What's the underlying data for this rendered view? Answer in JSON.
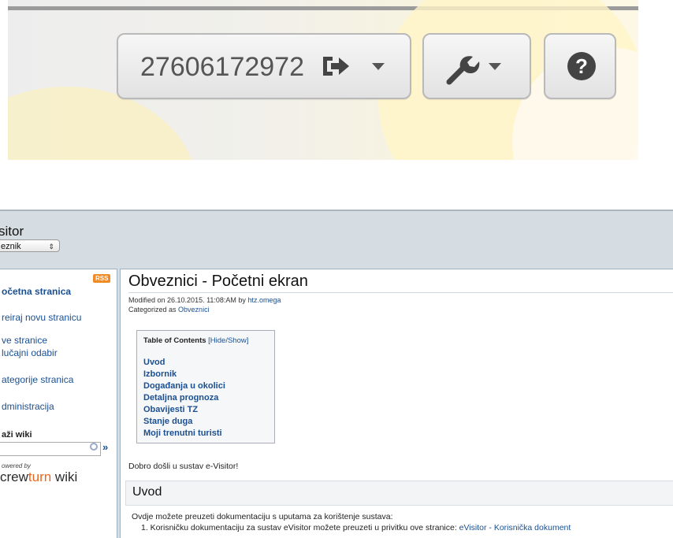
{
  "toolbar": {
    "user_id": "27606172972",
    "help_glyph": "?"
  },
  "wiki": {
    "site_title": "sitor",
    "namespace_select": "eznik",
    "rss_label": "RSS",
    "nav": [
      {
        "label": "očetna stranica"
      },
      {
        "label": "reiraj novu stranicu"
      },
      {
        "label": "ve stranice"
      },
      {
        "label": "lučajni odabir"
      },
      {
        "label": "ategorije stranica"
      },
      {
        "label": "dministracija"
      }
    ],
    "search_label": "aži wiki",
    "search_go": "»",
    "powered_by": "owered by",
    "logo_pre": "crew",
    "logo_accent": "turn",
    "logo_post": " wiki",
    "page": {
      "title": "Obveznici - Početni ekran",
      "modified_text": "Modified on 26.10.2015. 11:08:AM by ",
      "modified_user": "htz.omega",
      "categorized_text": "Categorized as ",
      "category": "Obveznici",
      "toc_title": "Table of Contents ",
      "toc_toggle": "[Hide/Show]",
      "toc": [
        "Uvod",
        "Izbornik",
        "Događanja u okolici",
        "Detaljna prognoza",
        "Obavijesti TZ",
        "Stanje duga",
        "Moji trenutni turisti"
      ],
      "welcome": "Dobro došli u sustav e-Visitor!",
      "section_title": "Uvod",
      "intro": "Ovdje možete preuzeti dokumentaciju s uputama za korištenje sustava:",
      "list_item_text": "1. Korisničku dokumentaciju za sustav eVisitor možete preuzeti u privitku ove stranice: ",
      "list_item_link": "eVisitor - Korisnička dokument"
    }
  }
}
